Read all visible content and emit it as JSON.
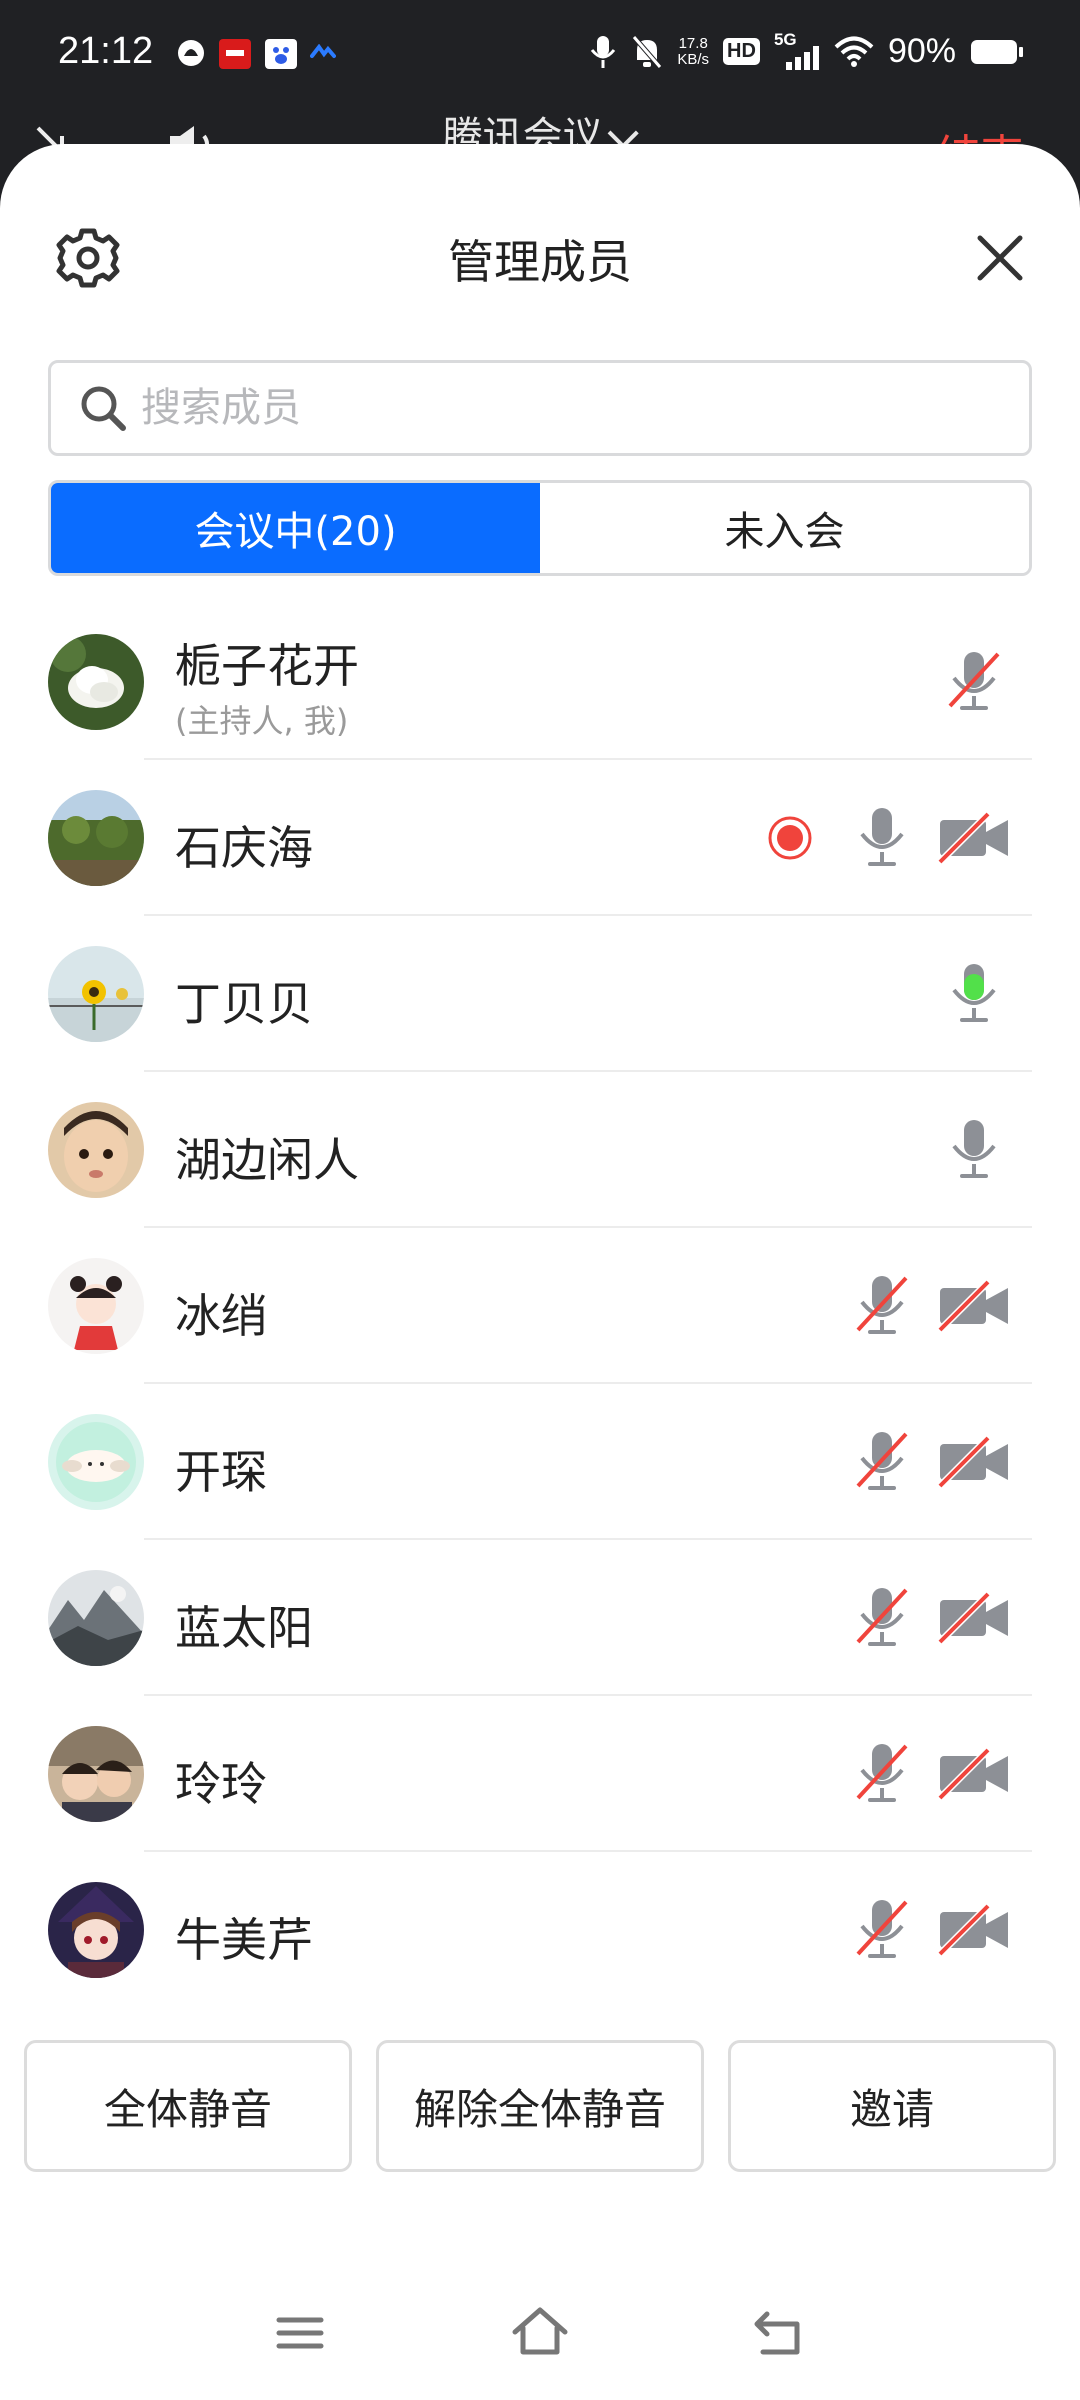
{
  "status_bar": {
    "time": "21:12",
    "net_speed_top": "17.8",
    "net_speed_unit": "KB/s",
    "hd_label": "HD",
    "net_type": "5G",
    "battery": "90%"
  },
  "meeting": {
    "title": "腾讯会议",
    "end_label": "结束"
  },
  "sheet": {
    "title": "管理成员",
    "search_placeholder": "搜索成员",
    "tabs": [
      {
        "label": "会议中(20)",
        "active": true
      },
      {
        "label": "未入会",
        "active": false
      }
    ]
  },
  "members": [
    {
      "name": "栀子花开",
      "sub": "(主持人, 我)",
      "mic": "muted",
      "cam": "none",
      "recording": false
    },
    {
      "name": "石庆海",
      "sub": "",
      "mic": "on",
      "cam": "off",
      "recording": true
    },
    {
      "name": "丁贝贝",
      "sub": "",
      "mic": "speaking",
      "cam": "none",
      "recording": false
    },
    {
      "name": "湖边闲人",
      "sub": "",
      "mic": "on",
      "cam": "none",
      "recording": false
    },
    {
      "name": "冰绡",
      "sub": "",
      "mic": "muted",
      "cam": "off",
      "recording": false
    },
    {
      "name": "开琛",
      "sub": "",
      "mic": "muted",
      "cam": "off",
      "recording": false
    },
    {
      "name": "蓝太阳",
      "sub": "",
      "mic": "muted",
      "cam": "off",
      "recording": false
    },
    {
      "name": "玲玲",
      "sub": "",
      "mic": "muted",
      "cam": "off",
      "recording": false
    },
    {
      "name": "牛美芹",
      "sub": "",
      "mic": "muted",
      "cam": "off",
      "recording": false
    }
  ],
  "actions": {
    "mute_all": "全体静音",
    "unmute_all": "解除全体静音",
    "invite": "邀请"
  },
  "colors": {
    "accent": "#0a6cff",
    "danger": "#f0443c",
    "speaking": "#52e04a"
  }
}
